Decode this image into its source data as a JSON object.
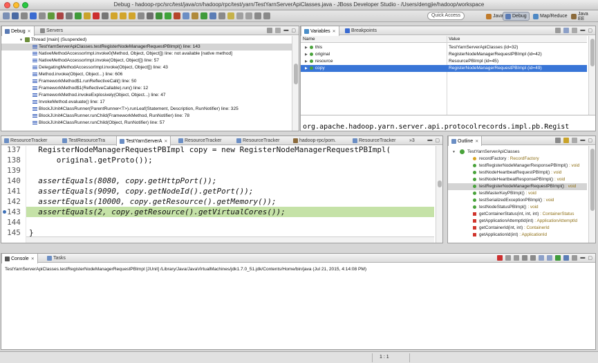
{
  "window": {
    "title": "Debug - hadoop-rpc/src/test/java/cn/hadoop/rpc/test/yarn/TestYarnServerApiClasses.java - JBoss Developer Studio - /Users/dengjie/hadoop/workspace"
  },
  "toolbar": {
    "quick_access": "Quick Access",
    "perspectives": [
      {
        "label": "Java",
        "color": "#c07a2a"
      },
      {
        "label": "Debug",
        "color": "#5a7bb5"
      },
      {
        "label": "Map/Reduce",
        "color": "#4d88c4"
      },
      {
        "label": "Java EE",
        "color": "#8b6a3a"
      }
    ]
  },
  "debug_panel": {
    "tabs": [
      {
        "label": "Debug"
      },
      {
        "label": "Servers"
      }
    ],
    "thread": "Thread [main] (Suspended)",
    "frames": [
      "TestYarnServerApiClasses.testRegisterNodeManagerRequestPBImpl() line: 143",
      "NativeMethodAccessorImpl.invoke0(Method, Object, Object[]) line: not available [native method]",
      "NativeMethodAccessorImpl.invoke(Object, Object[]) line: 57",
      "DelegatingMethodAccessorImpl.invoke(Object, Object[]) line: 43",
      "Method.invoke(Object, Object...) line: 606",
      "FrameworkMethod$1.runReflectiveCall() line: 50",
      "FrameworkMethod$1(ReflectiveCallable).run() line: 12",
      "FrameworkMethod.invokeExplosively(Object, Object...) line: 47",
      "InvokeMethod.evaluate() line: 17",
      "BlockJUnit4ClassRunner(ParentRunner<T>).runLeaf(Statement, Description, RunNotifier) line: 325",
      "BlockJUnit4ClassRunner.runChild(FrameworkMethod, RunNotifier) line: 78",
      "BlockJUnit4ClassRunner.runChild(Object, RunNotifier) line: 57"
    ]
  },
  "variables_panel": {
    "tabs": [
      {
        "label": "Variables"
      },
      {
        "label": "Breakpoints"
      }
    ],
    "columns": {
      "name": "Name",
      "value": "Value"
    },
    "rows": [
      {
        "name": "this",
        "value": "TestYarnServerApiClasses  (id=32)"
      },
      {
        "name": "original",
        "value": "RegisterNodeManagerRequestPBImpl  (id=42)"
      },
      {
        "name": "resource",
        "value": "ResourcePBImpl  (id=45)"
      },
      {
        "name": "copy",
        "value": "RegisterNodeManagerRequestPBImpl  (id=49)"
      }
    ],
    "detail": "org.apache.hadoop.yarn.server.api.protocolrecords.impl.pb.Regist"
  },
  "editor": {
    "tabs": [
      {
        "label": "ResourceTracker"
      },
      {
        "label": "TestResourceTra"
      },
      {
        "label": "TestYarnServerA"
      },
      {
        "label": "ResourceTracker"
      },
      {
        "label": "ResourceTracker"
      },
      {
        "label": "hadoop-rpc/pom."
      },
      {
        "label": "ResourceTracker"
      }
    ],
    "overflow": "»3",
    "lines": [
      {
        "no": "137",
        "text": "  RegisterNodeManagerRequestPBImpl copy = new RegisterNodeManagerRequestPBImpl("
      },
      {
        "no": "138",
        "text": "      original.getProto());"
      },
      {
        "no": "139",
        "text": ""
      },
      {
        "no": "140",
        "text": "  assertEquals(8080, copy.getHttpPort());"
      },
      {
        "no": "141",
        "text": "  assertEquals(9090, copy.getNodeId().getPort());"
      },
      {
        "no": "142",
        "text": "  assertEquals(10000, copy.getResource().getMemory());"
      },
      {
        "no": "143",
        "text": "  assertEquals(2, copy.getResource().getVirtualCores());"
      },
      {
        "no": "144",
        "text": ""
      },
      {
        "no": "145",
        "text": "}"
      }
    ]
  },
  "outline_panel": {
    "tab": "Outline",
    "class_name": "TestYarnServerApiClasses",
    "items": [
      {
        "name": "recordFactory",
        "type": " : RecordFactory",
        "color": "#d9a520"
      },
      {
        "name": "testRegisterNodeManagerResponsePBImpl()",
        "type": " : void",
        "color": "#48a23a"
      },
      {
        "name": "testNodeHeartbeatRequestPBImpl()",
        "type": " : void",
        "color": "#48a23a"
      },
      {
        "name": "testNodeHeartbeatResponsePBImpl()",
        "type": " : void",
        "color": "#48a23a"
      },
      {
        "name": "testRegisterNodeManagerRequestPBImpl()",
        "type": " : void",
        "color": "#48a23a"
      },
      {
        "name": "testMasterKeyPBImpl()",
        "type": " : void",
        "color": "#48a23a"
      },
      {
        "name": "testSerializedExceptionPBImpl()",
        "type": " : void",
        "color": "#48a23a"
      },
      {
        "name": "testNodeStatusPBImpl()",
        "type": " : void",
        "color": "#48a23a"
      },
      {
        "name": "getContainerStatus(int, int, int)",
        "type": " : ContainerStatus",
        "color": "#d0342c"
      },
      {
        "name": "getApplicationAttemptId(int)",
        "type": " : ApplicationAttemptId",
        "color": "#d0342c"
      },
      {
        "name": "getContainerId(int, int)",
        "type": " : ContainerId",
        "color": "#d0342c"
      },
      {
        "name": "getApplicationId(int)",
        "type": " : ApplicationId",
        "color": "#d0342c"
      }
    ]
  },
  "console_panel": {
    "tabs": [
      {
        "label": "Console"
      },
      {
        "label": "Tasks"
      }
    ],
    "info": "TestYarnServerApiClasses.testRegisterNodeManagerRequestPBImpl [JUnit] /Library/Java/JavaVirtualMachines/jdk1.7.0_51.jdk/Contents/Home/bin/java (Jul 21, 2015, 4:14:08 PM)"
  },
  "status": {
    "position": "1 : 1"
  }
}
